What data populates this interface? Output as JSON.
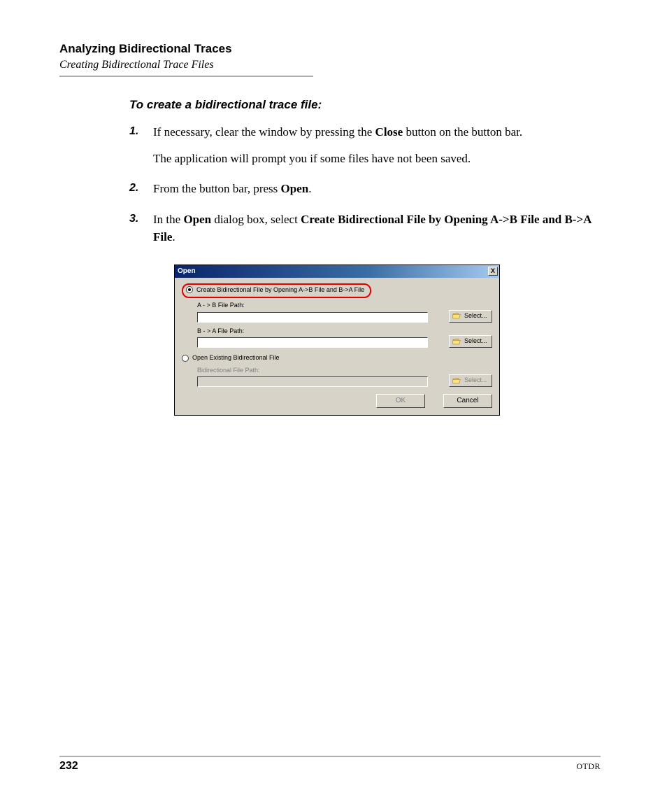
{
  "header": {
    "title": "Analyzing Bidirectional Traces",
    "subtitle": "Creating Bidirectional Trace Files"
  },
  "section": {
    "heading": "To create a bidirectional trace file:"
  },
  "steps": {
    "s1": {
      "num": "1.",
      "pre": "If necessary, clear the window by pressing the ",
      "bold": "Close",
      "post": " button on the button bar.",
      "para2": "The application will prompt you if some files have not been saved."
    },
    "s2": {
      "num": "2.",
      "pre": "From the button bar, press ",
      "bold": "Open",
      "post": "."
    },
    "s3": {
      "num": "3.",
      "t1": "In the ",
      "b1": "Open",
      "t2": " dialog box, select ",
      "b2": "Create Bidirectional File by Opening A->B File and B->A File",
      "t3": "."
    }
  },
  "dialog": {
    "title": "Open",
    "close_x": "X",
    "radio1": "Create Bidirectional File by Opening A->B File and B->A File",
    "ab_label": "A - > B File Path:",
    "ba_label": "B - > A File Path:",
    "select_label": "Select...",
    "radio2": "Open Existing Bidirectional File",
    "bidir_label": "Bidirectional File Path:",
    "ok": "OK",
    "cancel": "Cancel"
  },
  "footer": {
    "page": "232",
    "right": "OTDR"
  }
}
